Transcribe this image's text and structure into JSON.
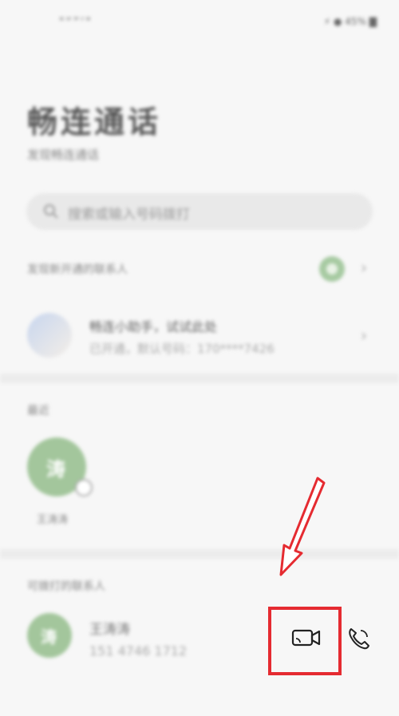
{
  "status_bar": {
    "left": "\"“”‘\"",
    "right": "⚡ ● 45% ▇"
  },
  "header": {
    "title": "畅连通话",
    "subtitle": "发现畅连通话"
  },
  "search": {
    "placeholder": "搜索或输入号码拨打"
  },
  "new_contacts": {
    "label": "发现新开通的联系人"
  },
  "recommend": {
    "name": "畅连小助手，试试此处",
    "desc": "已开通，默认号码：170****7426"
  },
  "recent": {
    "label": "最近",
    "avatar_char": "涛",
    "name": "王涛涛"
  },
  "contacts": {
    "label": "可拨打的联系人",
    "items": [
      {
        "avatar_char": "涛",
        "name": "王涛涛",
        "phone": "151 4746 1712"
      }
    ]
  },
  "icons": {
    "video": "video-camera-icon",
    "voice": "phone-icon",
    "search": "search-icon"
  },
  "colors": {
    "accent_green": "#a3c69c",
    "annotation_red": "#e52b31"
  }
}
